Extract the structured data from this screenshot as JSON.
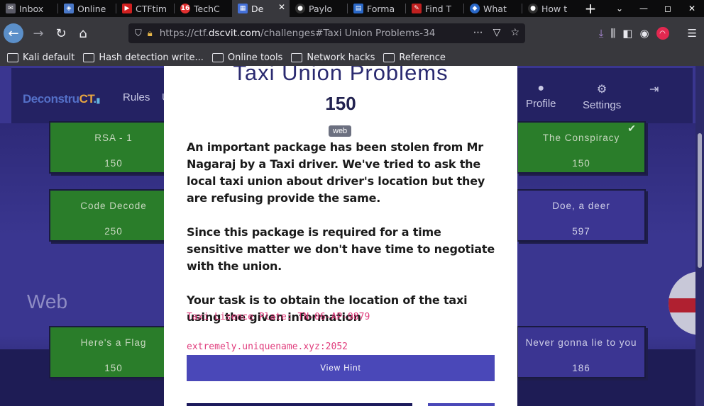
{
  "browser": {
    "tabs": [
      {
        "label": "Inbox",
        "icon_color": "#c0c0c8",
        "icon_name": "mail-icon"
      },
      {
        "label": "Online",
        "icon_color": "#4a78c8",
        "icon_name": "shield-icon"
      },
      {
        "label": "CTFtim",
        "icon_color": "#d02020",
        "icon_name": "ctftime-icon"
      },
      {
        "label": "TechC",
        "icon_color": "#e03030",
        "icon_name": "badge-icon",
        "badge": "16"
      },
      {
        "label": "De",
        "icon_color": "#4470d8",
        "icon_name": "deconstruct-icon",
        "active": true
      },
      {
        "label": "Paylo",
        "icon_color": "#303030",
        "icon_name": "github-icon"
      },
      {
        "label": "Forma",
        "icon_color": "#2a68c8",
        "icon_name": "table-icon"
      },
      {
        "label": "Find T",
        "icon_color": "#c02020",
        "icon_name": "pin-icon"
      },
      {
        "label": "What",
        "icon_color": "#2a68c8",
        "icon_name": "drop-icon"
      },
      {
        "label": "How t",
        "icon_color": "#303030",
        "icon_name": "github-icon"
      }
    ],
    "url_prefix": "https://ctf.",
    "url_domain": "dscvit.com",
    "url_path": "/challenges#Taxi Union Problems-34",
    "bookmarks": [
      "Kali default",
      "Hash detection write...",
      "Online tools",
      "Network hacks",
      "Reference"
    ]
  },
  "site": {
    "logo_part1": "Deconstru",
    "logo_part2": "CT",
    "logo_part3": ".",
    "nav_rules": "Rules",
    "nav_partial": "U",
    "profile_label": "Profile",
    "settings_label": "Settings"
  },
  "cards": {
    "rsa": {
      "name": "RSA - 1",
      "points": "150"
    },
    "conspiracy": {
      "name": "The Conspiracy",
      "points": "150"
    },
    "code_decode": {
      "name": "Code Decode",
      "points": "250"
    },
    "doe": {
      "name": "Doe, a deer",
      "points": "597"
    },
    "flag": {
      "name": "Here's a Flag",
      "points": "150"
    },
    "never": {
      "name": "Never gonna lie to you",
      "points": "186"
    }
  },
  "section": {
    "web_title": "Web"
  },
  "modal": {
    "title": "Taxi Union Problems",
    "points": "150",
    "tag": "web",
    "desc_p1": "An important package has been stolen from Mr Nagaraj by a Taxi driver. We've tried to ask the local taxi union about driver's location but they are refusing provide the same.",
    "desc_p2": "Since this package is required for a time sensitive matter we don't have time to negotiate with the union.",
    "desc_p3": "Your task is to obtain the location of the taxi using the given information",
    "code1": "Taxi Lisence Plate: TN-06-AP-9879",
    "code2": "extremely.uniquename.xyz:2052",
    "hint_label": "View Hint"
  }
}
